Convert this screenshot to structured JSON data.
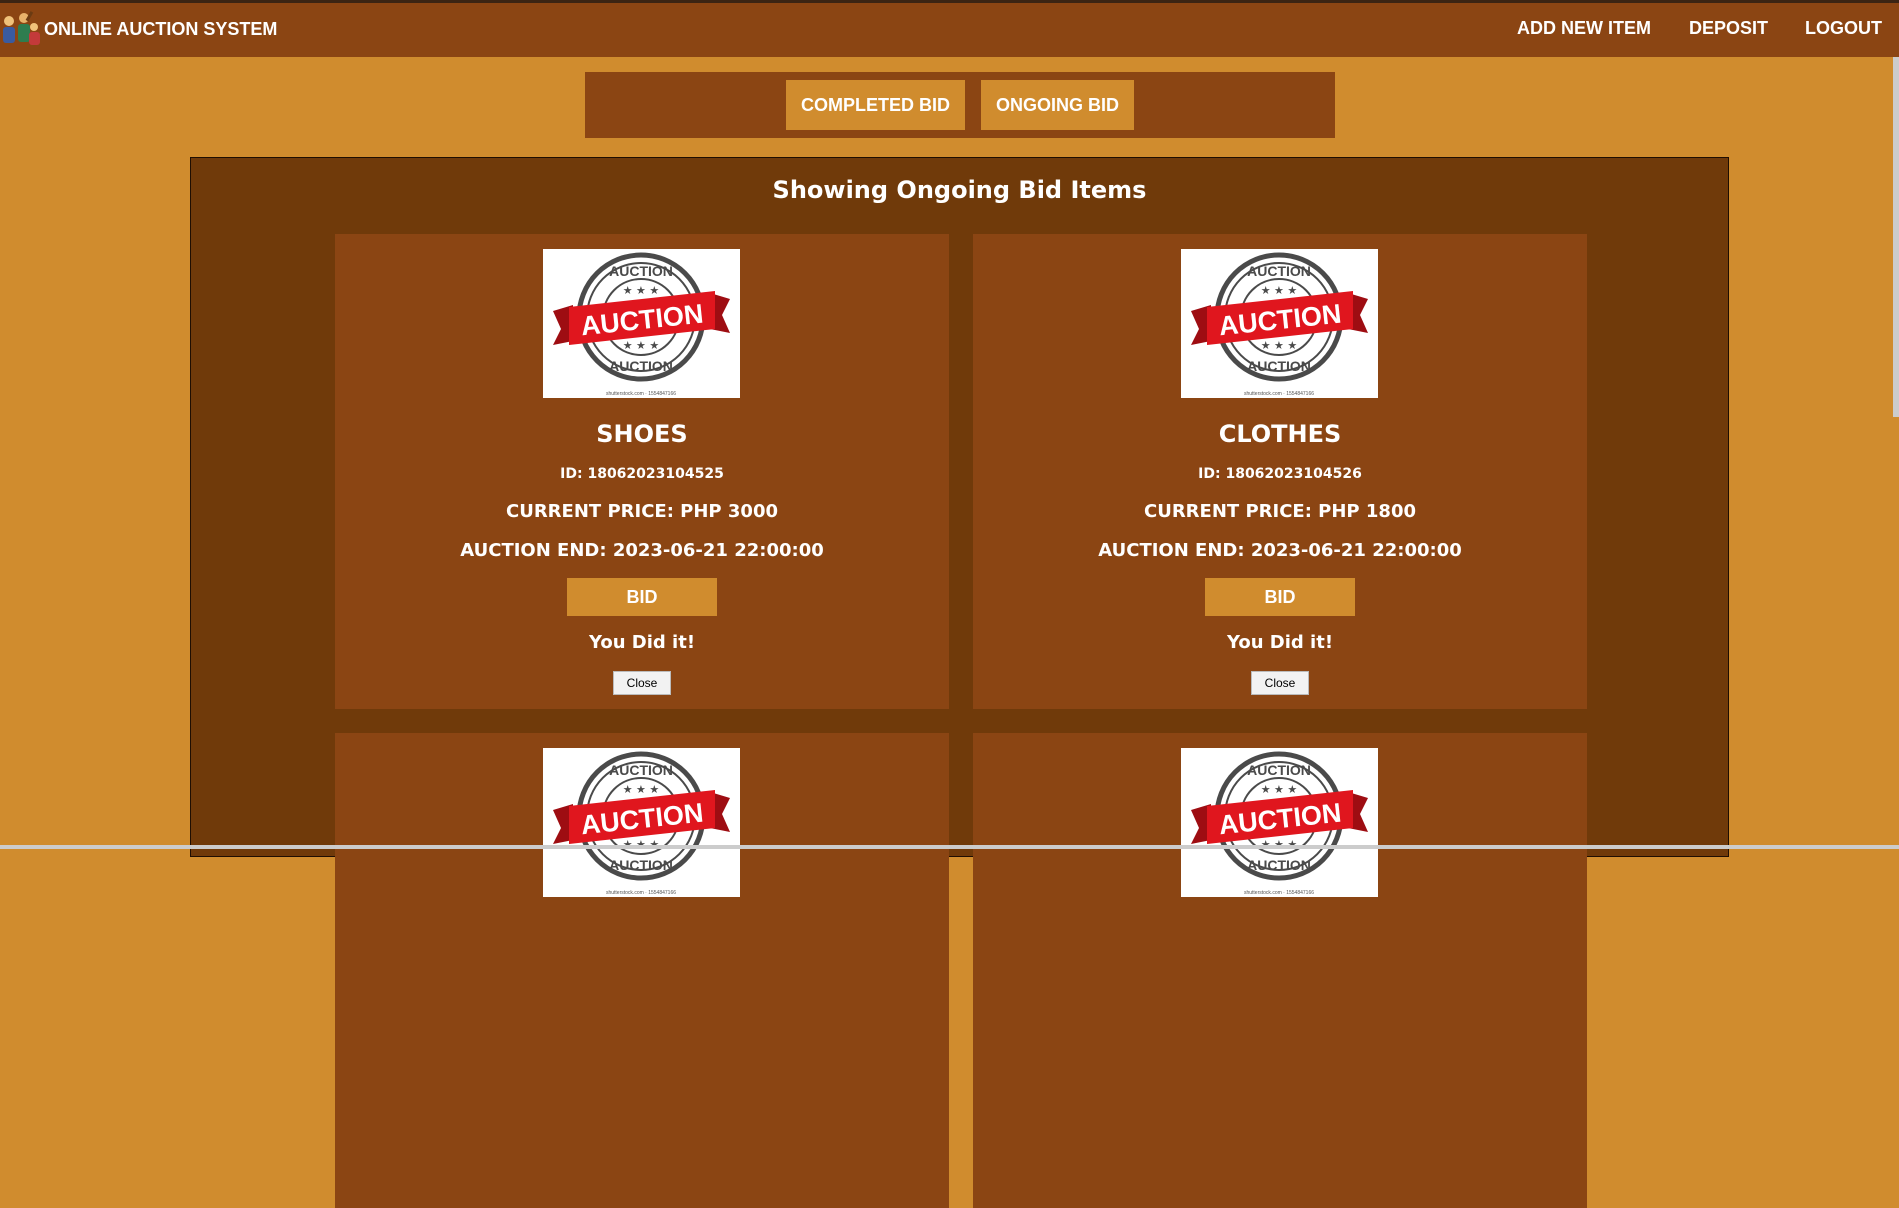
{
  "header": {
    "brand": "ONLINE AUCTION SYSTEM",
    "nav": [
      "ADD NEW ITEM",
      "DEPOSIT",
      "LOGOUT"
    ]
  },
  "tabs": {
    "completed": "COMPLETED BID",
    "ongoing": "ONGOING BID"
  },
  "main": {
    "heading": "Showing Ongoing Bid Items"
  },
  "items": [
    {
      "name": "SHOES",
      "id": "ID: 18062023104525",
      "price": "CURRENT PRICE: PHP 3000",
      "end": "AUCTION END: 2023-06-21 22:00:00",
      "bid": "BID",
      "message": "You Did it!",
      "close": "Close"
    },
    {
      "name": "CLOTHES",
      "id": "ID: 18062023104526",
      "price": "CURRENT PRICE: PHP 1800",
      "end": "AUCTION END: 2023-06-21 22:00:00",
      "bid": "BID",
      "message": "You Did it!",
      "close": "Close"
    }
  ],
  "stamp": {
    "ring_text": "AUCTION",
    "banner_text": "AUCTION",
    "credit": "shutterstock.com · 1554847166"
  },
  "colors": {
    "page_bg": "#D08C2E",
    "bar": "#8B4513",
    "main_bg": "#703A0A",
    "stamp_red": "#E0161E"
  }
}
